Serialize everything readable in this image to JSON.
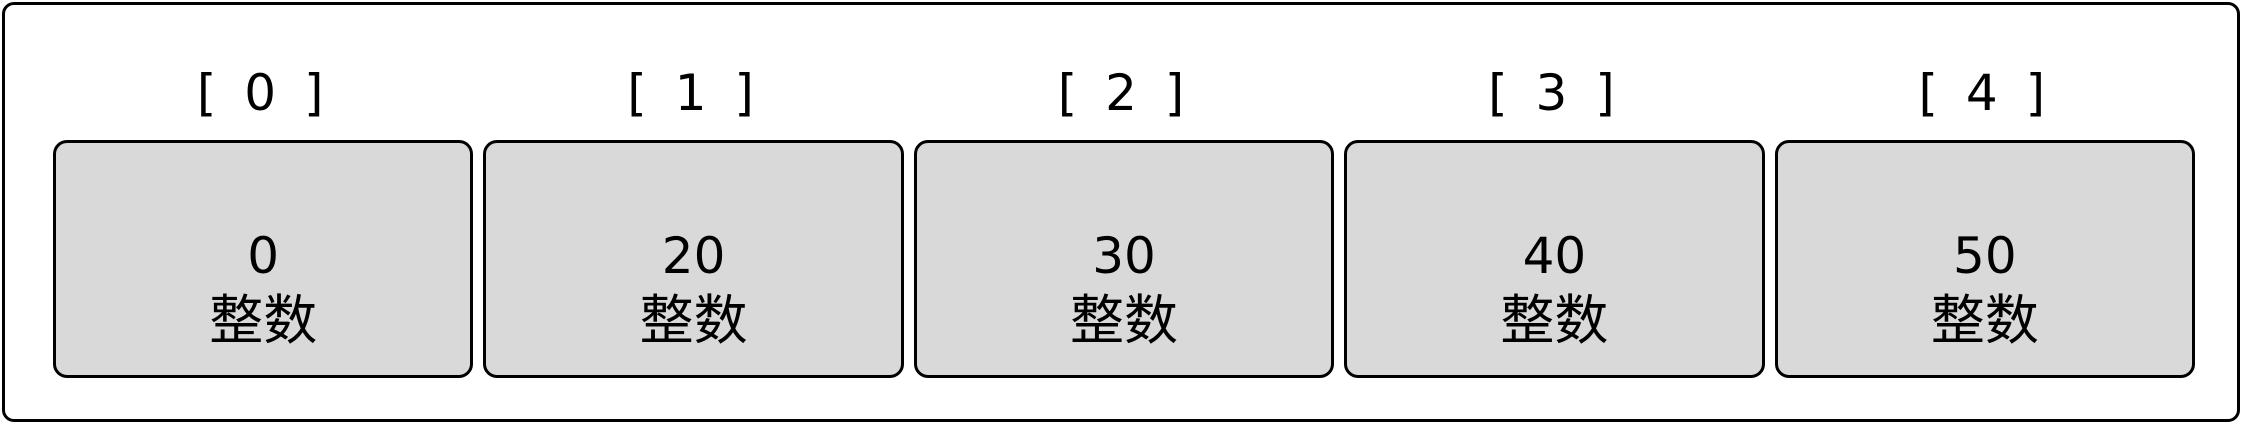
{
  "array": {
    "elements": [
      {
        "index": "[ 0 ]",
        "value": "0",
        "type": "整数"
      },
      {
        "index": "[ 1 ]",
        "value": "20",
        "type": "整数"
      },
      {
        "index": "[ 2 ]",
        "value": "30",
        "type": "整数"
      },
      {
        "index": "[ 3 ]",
        "value": "40",
        "type": "整数"
      },
      {
        "index": "[ 4 ]",
        "value": "50",
        "type": "整数"
      }
    ]
  },
  "colors": {
    "cell_fill": "#d9d9d9",
    "border": "#000000",
    "background": "#ffffff"
  }
}
